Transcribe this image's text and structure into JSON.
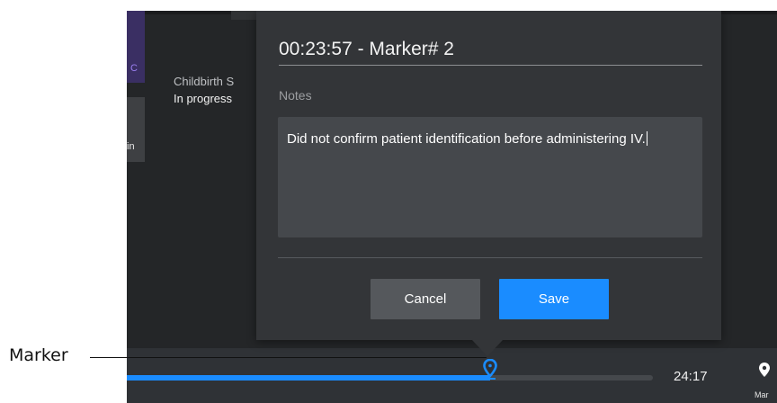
{
  "callout": {
    "label": "Marker"
  },
  "background": {
    "left_chip_text": "C",
    "left_button_text": "in",
    "scenario_title": "Childbirth S",
    "scenario_status": "In progress"
  },
  "dialog": {
    "title": "00:23:57 - Marker# 2",
    "notes_label": "Notes",
    "notes_value": "Did not confirm patient identification before administering IV.",
    "cancel_label": "Cancel",
    "save_label": "Save"
  },
  "timeline": {
    "progress": 0.69,
    "time_label": "24:17",
    "marker_tool_label": "Mar"
  },
  "colors": {
    "accent": "#1a8cff",
    "background": "#242628",
    "dialog": "#333538"
  }
}
